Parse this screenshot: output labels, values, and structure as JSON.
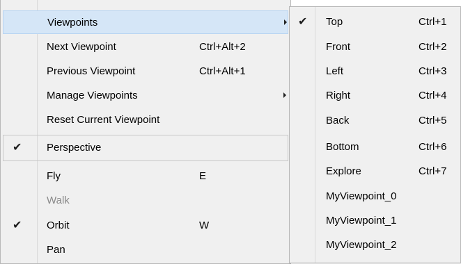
{
  "main_menu": {
    "viewpoints": {
      "label": "Viewpoints"
    },
    "next_viewpoint": {
      "label": "Next Viewpoint",
      "shortcut": "Ctrl+Alt+2"
    },
    "previous_viewpoint": {
      "label": "Previous Viewpoint",
      "shortcut": "Ctrl+Alt+1"
    },
    "manage_viewpoints": {
      "label": "Manage Viewpoints"
    },
    "reset_viewpoint": {
      "label": "Reset Current Viewpoint"
    },
    "perspective": {
      "label": "Perspective",
      "checked": true
    },
    "fly": {
      "label": "Fly",
      "shortcut": "E"
    },
    "walk": {
      "label": "Walk",
      "disabled": true
    },
    "orbit": {
      "label": "Orbit",
      "shortcut": "W",
      "checked": true
    },
    "pan": {
      "label": "Pan"
    }
  },
  "sub_menu": {
    "items": [
      {
        "label": "Top",
        "shortcut": "Ctrl+1",
        "checked": true
      },
      {
        "label": "Front",
        "shortcut": "Ctrl+2"
      },
      {
        "label": "Left",
        "shortcut": "Ctrl+3"
      },
      {
        "label": "Right",
        "shortcut": "Ctrl+4"
      },
      {
        "label": "Back",
        "shortcut": "Ctrl+5"
      },
      {
        "label": "Bottom",
        "shortcut": "Ctrl+6"
      },
      {
        "label": "Explore",
        "shortcut": "Ctrl+7"
      },
      {
        "label": "MyViewpoint_0"
      },
      {
        "label": "MyViewpoint_1"
      },
      {
        "label": "MyViewpoint_2"
      }
    ]
  },
  "icons": {
    "check": "✔"
  }
}
